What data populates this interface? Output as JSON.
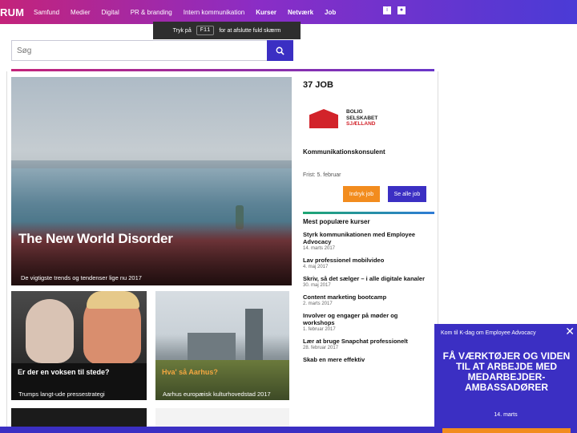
{
  "header": {
    "logo": "RUM",
    "nav": [
      "Samfund",
      "Medier",
      "Digital",
      "PR & branding",
      "Intern kommunikation",
      "Kurser",
      "Netværk",
      "Job"
    ],
    "nav_strong": [
      "Kurser",
      "Netværk",
      "Job"
    ]
  },
  "fullscreen_notice": {
    "prefix": "Tryk på",
    "key": "F11",
    "suffix": "for at afslutte fuld skærm"
  },
  "search": {
    "placeholder": "Søg"
  },
  "hero": {
    "title": "The New World Disorder",
    "subtitle": "De vigtigste trends og tendenser lige nu 2017"
  },
  "cards": [
    {
      "label": "Er der en voksen til stede?",
      "caption": "Trumps langt-ude pressestrategi"
    },
    {
      "label": "Hva' så Aarhus?",
      "caption": "Aarhus europæisk kulturhovedstad 2017"
    }
  ],
  "jobs": {
    "count_label": "37 JOB",
    "company_lines": [
      "BOLIG",
      "SELSKABET",
      "SJÆLLAND"
    ],
    "title": "Kommunikationskonsulent",
    "deadline": "Frist: 5. februar",
    "btn_post": "Indryk job",
    "btn_all": "Se alle job"
  },
  "courses": {
    "heading": "Mest populære kurser",
    "items": [
      {
        "title": "Styrk kommunikationen med Employee Advocacy",
        "date": "14. marts 2017"
      },
      {
        "title": "Lav professionel mobilvideo",
        "date": "4. maj 2017"
      },
      {
        "title": "Skriv, så det sælger – i alle digitale kanaler",
        "date": "30. maj 2017"
      },
      {
        "title": "Content marketing bootcamp",
        "date": "2. marts 2017"
      },
      {
        "title": "Involver og engager på møder og workshops",
        "date": "1. februar 2017"
      },
      {
        "title": "Lær at bruge Snapchat professionelt",
        "date": "28. februar 2017"
      },
      {
        "title": "Skab en mere effektiv",
        "date": ""
      }
    ]
  },
  "promo": {
    "top": "Kom til K-dag om Employee Advocacy",
    "headline": "FÅ VÆRKTØJER OG VIDEN TIL AT ARBEJDE MED MEDARBEJDER-AMBASSADØRER",
    "date": "14. marts",
    "close": "✕"
  }
}
